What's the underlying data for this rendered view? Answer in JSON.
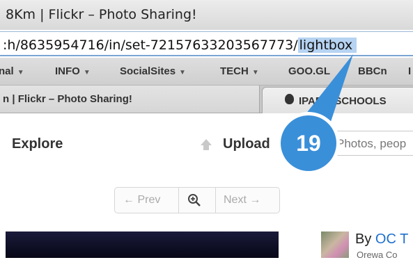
{
  "window": {
    "title": "8Km | Flickr – Photo Sharing!"
  },
  "address_bar": {
    "url_prefix": ":h/8635954716/in/set-72157633203567773/",
    "url_selected": "lightbox"
  },
  "bookmarks": [
    {
      "label": "nal",
      "has_menu": true
    },
    {
      "label": "INFO",
      "has_menu": true
    },
    {
      "label": "SocialSites",
      "has_menu": true
    },
    {
      "label": "TECH",
      "has_menu": true
    },
    {
      "label": "GOO.GL",
      "has_menu": false
    },
    {
      "label": "BBCn",
      "has_menu": false
    },
    {
      "label": "I",
      "has_menu": false
    }
  ],
  "tabs": [
    {
      "label": "n | Flickr – Photo Sharing!",
      "active": true
    },
    {
      "label": "IPAD 4 SCHOOLS",
      "active": false
    }
  ],
  "page": {
    "nav_explore": "Explore",
    "nav_upload": "Upload",
    "search_placeholder": "Photos, peop",
    "pager_prev": "← Prev",
    "pager_next": "Next →",
    "by_prefix": "By",
    "by_name": "OC T",
    "group_text": "Orewa Co"
  },
  "annotation": {
    "number": "19",
    "color": "#3a8fd9"
  },
  "colors": {
    "link": "#1e6fcf",
    "url_selection": "#b6d3f2",
    "callout": "#3a8fd9"
  }
}
